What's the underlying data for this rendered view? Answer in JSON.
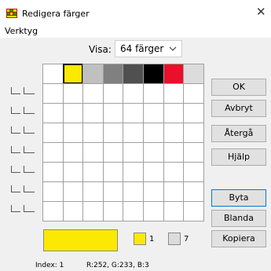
{
  "window": {
    "title": "Redigera färger"
  },
  "menu": {
    "items": [
      "Verktyg"
    ]
  },
  "show": {
    "label": "Visa:",
    "selected": "64 färger"
  },
  "palette": {
    "top_row": [
      "#ffffff",
      "#fce903",
      "#c0c0c0",
      "#808080",
      "#505050",
      "#000000",
      "#e8102a",
      "#dcdcdc"
    ],
    "selected_index": 1,
    "empty_rows": 7,
    "columns": 8
  },
  "preview": {
    "color": "#fce903",
    "swatch1_label": "1",
    "swatch2_label": "7"
  },
  "buttons": {
    "ok": "OK",
    "cancel": "Avbryt",
    "revert": "Återgå",
    "help": "Hjälp",
    "swap": "Byta",
    "blend": "Blanda",
    "copy": "Kopiera"
  },
  "status": {
    "index": "Index: 1",
    "rgb": "R:252, G:233, B:3"
  },
  "icons": {
    "app": "palette-icon",
    "close": "close-icon",
    "dropdown": "chevron-down-icon"
  }
}
